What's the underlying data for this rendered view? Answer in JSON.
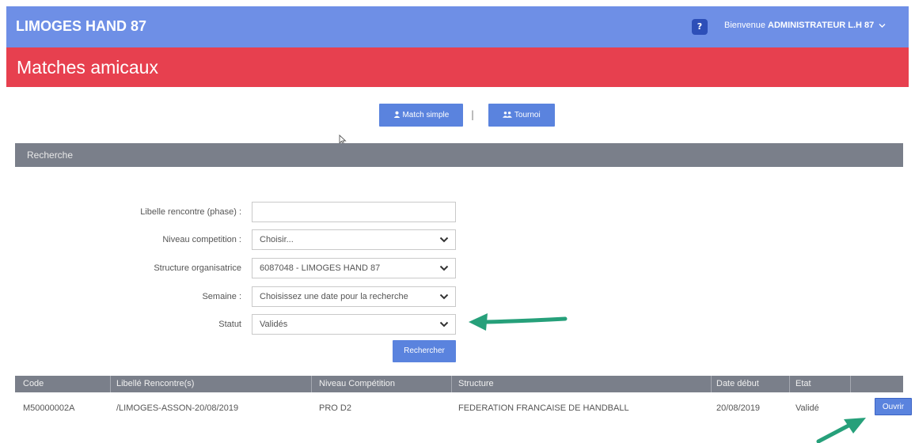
{
  "header": {
    "brand": "LIMOGES HAND 87",
    "help": "?",
    "welcome_prefix": "Bienvenue ",
    "welcome_user": "ADMINISTRATEUR L.H 87",
    "chevron_icon": "chevron-down-icon"
  },
  "page": {
    "title": "Matches amicaux"
  },
  "actions": {
    "match_simple": "Match simple",
    "separator": "|",
    "tournoi": "Tournoi"
  },
  "search": {
    "title": "Recherche",
    "fields": [
      {
        "label": "Libelle rencontre (phase) :",
        "value": ""
      },
      {
        "label": "Niveau competition :",
        "value": "Choisir..."
      },
      {
        "label": "Structure organisatrice",
        "value": "6087048 - LIMOGES HAND 87"
      },
      {
        "label": "Semaine :",
        "value": "Choisissez une date pour la recherche"
      },
      {
        "label": "Statut",
        "value": "Validés"
      }
    ],
    "submit": "Rechercher"
  },
  "table": {
    "headers": [
      "Code",
      "Libellé Rencontre(s)",
      "Niveau Compétition",
      "Structure",
      "Date début",
      "Etat"
    ],
    "rows": [
      [
        "M50000002A",
        "/LIMOGES-ASSON-20/08/2019",
        "PRO D2",
        "FEDERATION FRANCAISE DE HANDBALL",
        "20/08/2019",
        "Validé"
      ]
    ],
    "row_action": "Ouvrir"
  },
  "colors": {
    "topbar": "#6e8fe6",
    "titlebar": "#e7404f",
    "button": "#5a83de",
    "sectionbar": "#7a7f8a",
    "annotation_arrow": "#26a07a"
  }
}
